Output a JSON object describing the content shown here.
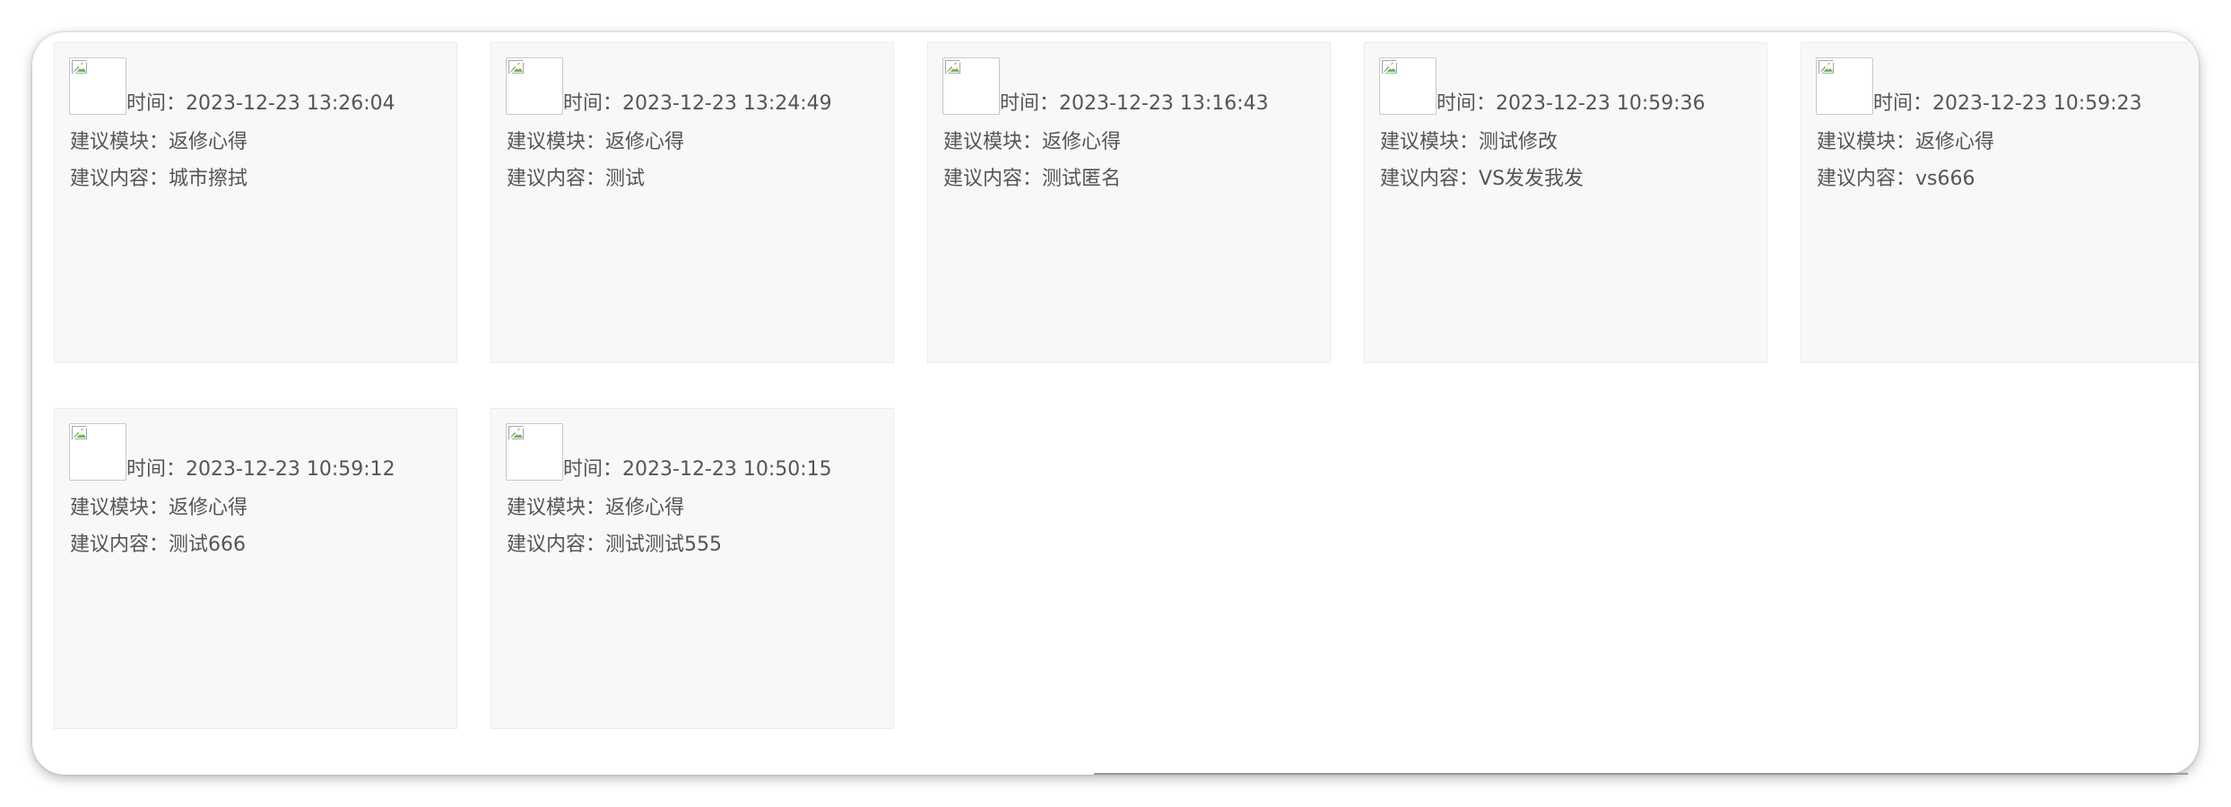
{
  "labels": {
    "time": "时间：",
    "module": "建议模块：",
    "content": "建议内容："
  },
  "cards": [
    {
      "time": "2023-12-23 13:26:04",
      "module": "返修心得",
      "content": "城市擦拭"
    },
    {
      "time": "2023-12-23 13:24:49",
      "module": "返修心得",
      "content": "测试"
    },
    {
      "time": "2023-12-23 13:16:43",
      "module": "返修心得",
      "content": "测试匿名"
    },
    {
      "time": "2023-12-23 10:59:36",
      "module": "测试修改",
      "content": "VS发发我发"
    },
    {
      "time": "2023-12-23 10:59:23",
      "module": "返修心得",
      "content": "vs666"
    },
    {
      "time": "2023-12-23 10:59:12",
      "module": "返修心得",
      "content": "测试666"
    },
    {
      "time": "2023-12-23 10:50:15",
      "module": "返修心得",
      "content": "测试测试555"
    }
  ],
  "icons": {
    "card_image": "broken-image-icon"
  },
  "colors": {
    "card_bg": "#f8f8f8",
    "card_border": "#ebebeb",
    "text": "#555555"
  }
}
